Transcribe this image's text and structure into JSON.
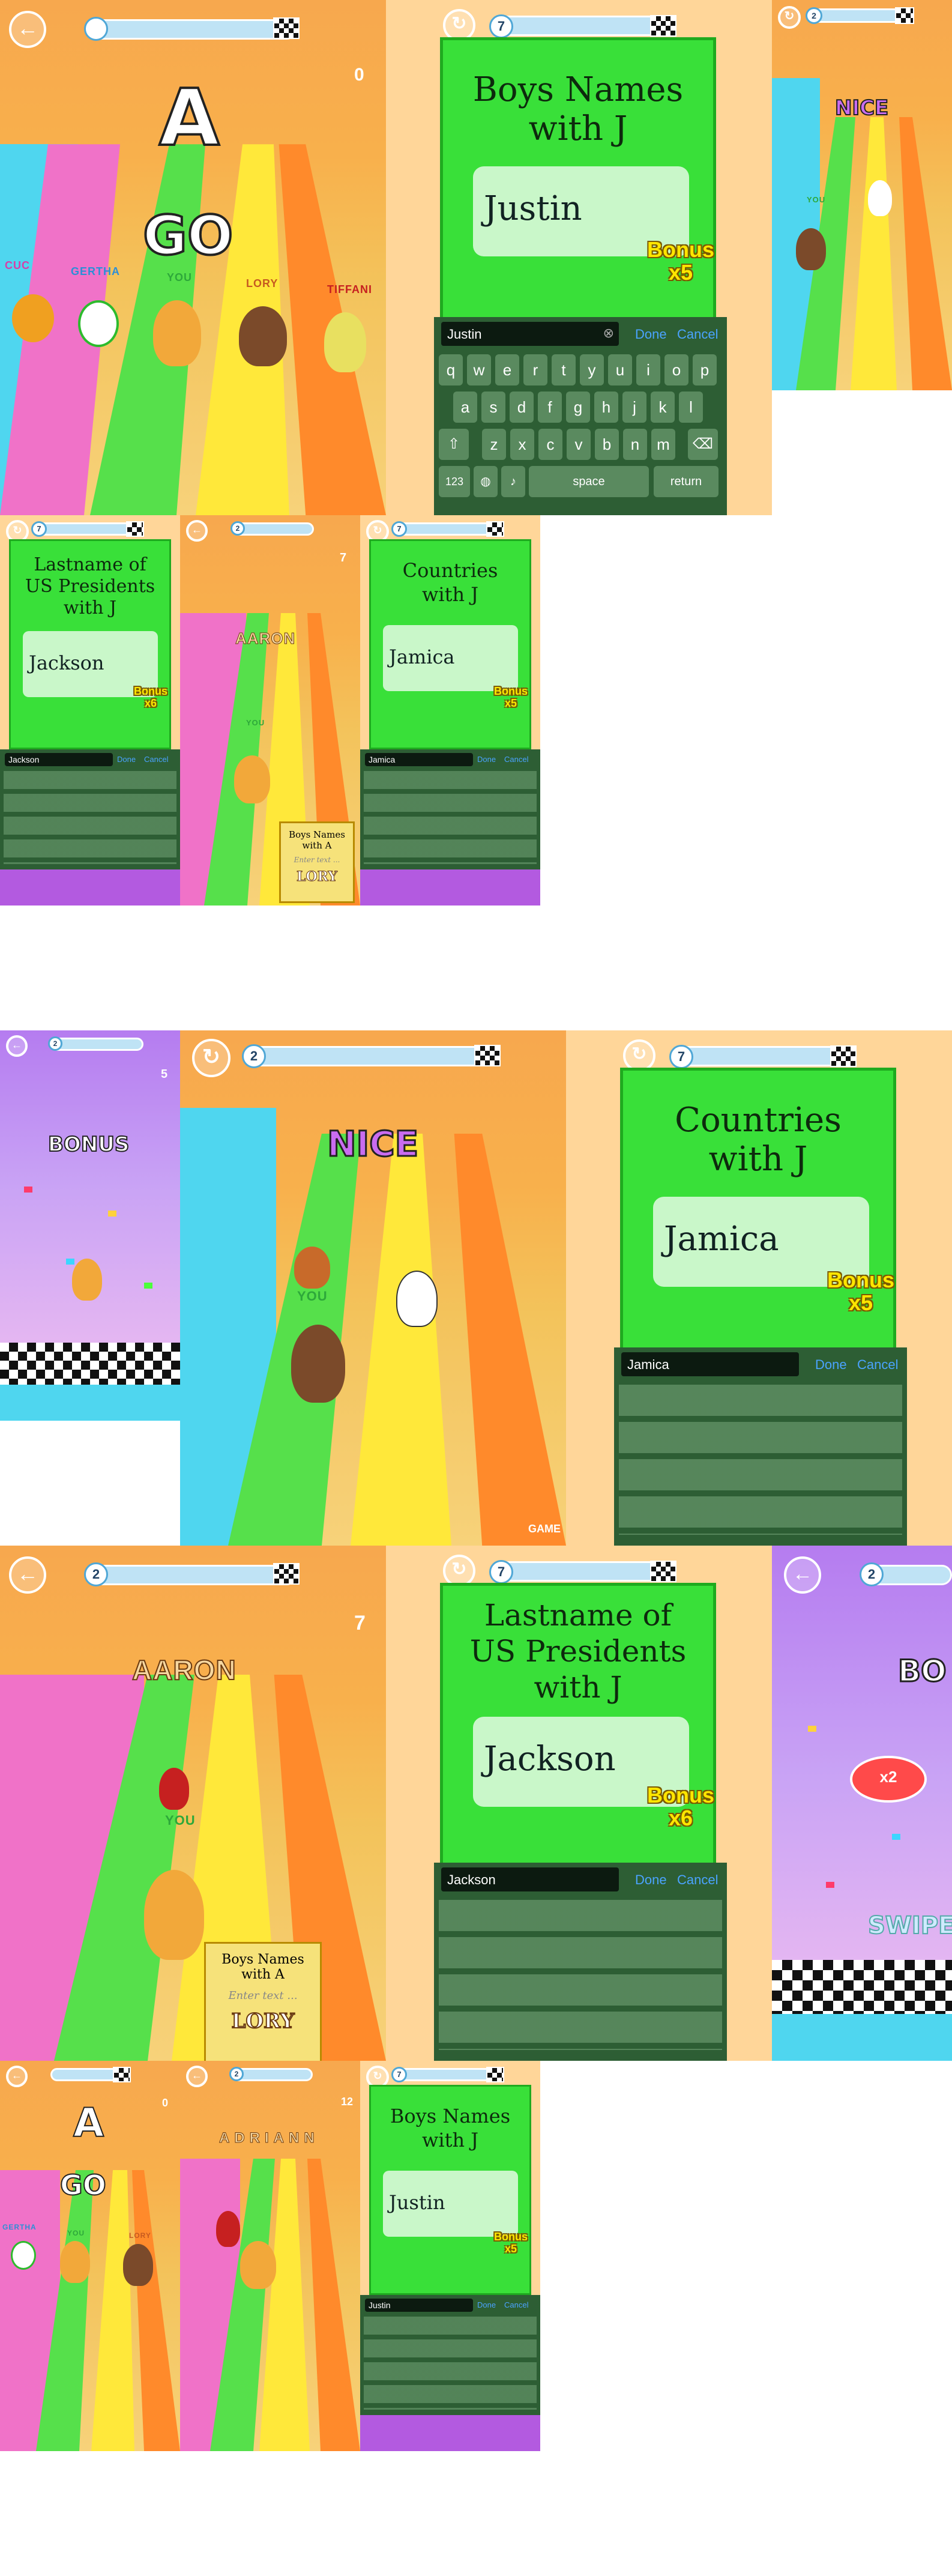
{
  "screens": {
    "s1": {
      "letter": "A",
      "go": "GO",
      "score": "0",
      "names": [
        "CUC",
        "GERTHA",
        "YOU",
        "LORY",
        "TIFFANI"
      ]
    },
    "s2": {
      "level": "7",
      "title_lines": [
        "Boys Names",
        "with J"
      ],
      "answer": "Justin",
      "bonus": [
        "Bonus",
        "x5"
      ],
      "input": "Justin",
      "done": "Done",
      "cancel": "Cancel"
    },
    "s3": {
      "level": "2",
      "label": "NICE",
      "you": "YOU"
    },
    "s4": {
      "level": "7",
      "title_lines": [
        "Lastname of",
        "US Presidents",
        "with J"
      ],
      "answer": "Jackson",
      "bonus": [
        "Bonus",
        "x6"
      ],
      "input": "Jackson",
      "done": "Done",
      "cancel": "Cancel"
    },
    "s5": {
      "level": "2",
      "name": "AARON",
      "score": "7",
      "sign_lines": [
        "Boys Names",
        "with A"
      ],
      "sign_placeholder": "Enter text ...",
      "sign_owner": "LORY",
      "you": "YOU"
    },
    "s6": {
      "level": "7",
      "title_lines": [
        "Countries",
        "with J"
      ],
      "answer": "Jamica",
      "bonus": [
        "Bonus",
        "x5"
      ],
      "input": "Jamica",
      "done": "Done",
      "cancel": "Cancel"
    },
    "s7": {
      "level": "2",
      "label": "BONUS",
      "score": "5"
    },
    "s8": {
      "level": "2",
      "label": "NICE",
      "you": "YOU",
      "watermark": "GAME"
    },
    "s9": {
      "level": "7",
      "title_lines": [
        "Countries",
        "with J"
      ],
      "answer": "Jamica",
      "bonus": [
        "Bonus",
        "x5"
      ],
      "input": "Jamica",
      "done": "Done",
      "cancel": "Cancel"
    },
    "s10": {
      "level": "2",
      "name": "AARON",
      "score": "7",
      "sign_lines": [
        "Boys Names",
        "with A"
      ],
      "sign_placeholder": "Enter text ...",
      "sign_owner": "LORY",
      "you": "YOU"
    },
    "s11": {
      "level": "7",
      "title_lines": [
        "Lastname of",
        "US Presidents",
        "with J"
      ],
      "answer": "Jackson",
      "bonus": [
        "Bonus",
        "x6"
      ],
      "input": "Jackson",
      "done": "Done",
      "cancel": "Cancel"
    },
    "s12": {
      "level": "2",
      "label": "BO",
      "multiplier": "x2",
      "swipe": "SWIPE"
    },
    "s13": {
      "letter": "A",
      "go": "GO",
      "score": "0",
      "names": [
        "GERTHA",
        "YOU",
        "LORY"
      ]
    },
    "s14": {
      "level": "2",
      "name": "ADRIANN",
      "score": "12"
    },
    "s15": {
      "level": "7",
      "title_lines": [
        "Boys Names",
        "with J"
      ],
      "answer": "Justin",
      "bonus": [
        "Bonus",
        "x5"
      ],
      "input": "Justin",
      "done": "Done",
      "cancel": "Cancel"
    }
  },
  "keyboard": {
    "row1": [
      "q",
      "w",
      "e",
      "r",
      "t",
      "y",
      "u",
      "i",
      "o",
      "p"
    ],
    "row2": [
      "a",
      "s",
      "d",
      "f",
      "g",
      "h",
      "j",
      "k",
      "l"
    ],
    "row3": [
      "z",
      "x",
      "c",
      "v",
      "b",
      "n",
      "m"
    ],
    "num": "123",
    "space": "space",
    "ret": "return"
  },
  "icons": {
    "back": "back-arrow-icon",
    "restart": "restart-icon",
    "finish": "finish-flag-icon",
    "shift": "shift-icon",
    "delete": "delete-icon",
    "globe": "globe-icon",
    "mic": "microphone-icon",
    "clear": "clear-icon"
  },
  "colors": {
    "green_card": "#39e039",
    "bonus_yellow": "#ffe600",
    "keyboard": "#2d5e34",
    "hud_blue": "#bfe3f5"
  }
}
